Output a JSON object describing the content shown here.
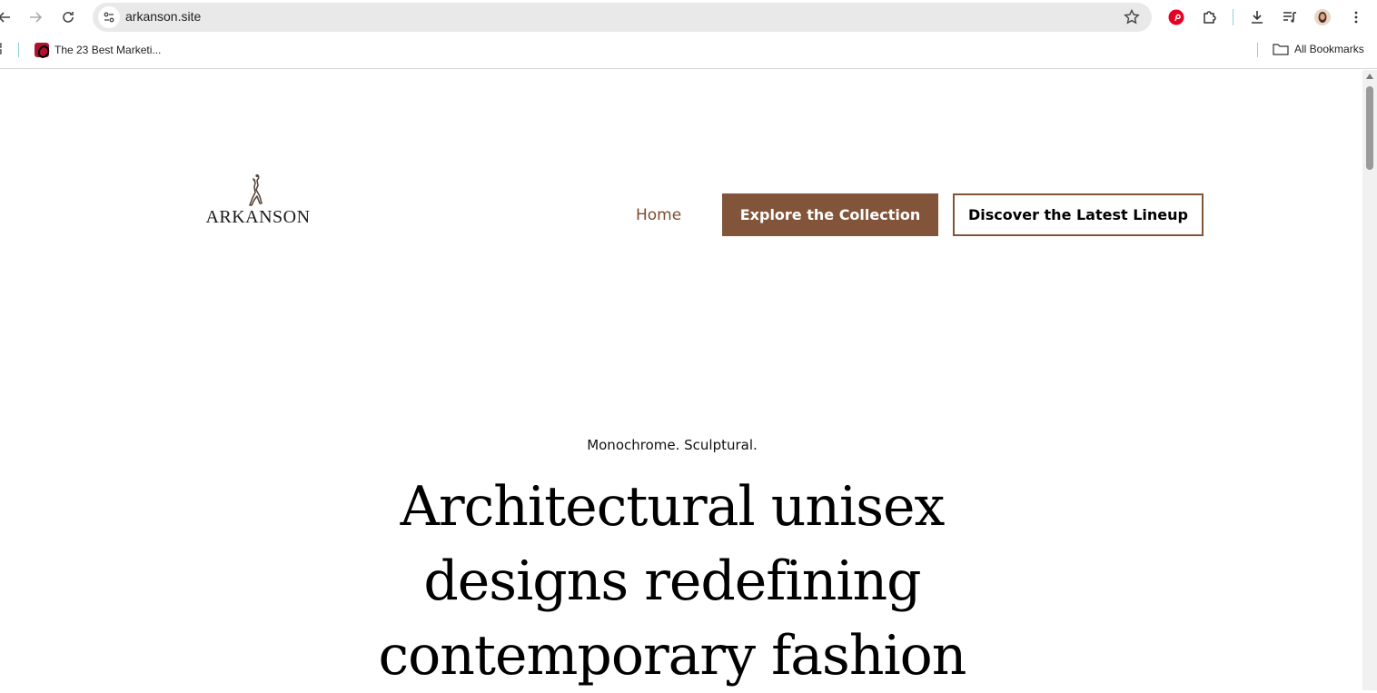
{
  "browser": {
    "url": "arkanson.site",
    "bookmarks": [
      {
        "label": "The 23 Best Marketi..."
      }
    ],
    "all_bookmarks_label": "All Bookmarks"
  },
  "site": {
    "logo_text": "ARKANSON",
    "nav": {
      "home_label": "Home",
      "explore_label": "Explore the Collection",
      "discover_label": "Discover the Latest Lineup"
    },
    "hero": {
      "tagline": "Monochrome. Sculptural.",
      "headline_lines": [
        "Architectural unisex",
        "designs redefining",
        "contemporary fashion"
      ]
    }
  },
  "colors": {
    "accent": "#82553a",
    "nav_text": "#7a4d33"
  }
}
